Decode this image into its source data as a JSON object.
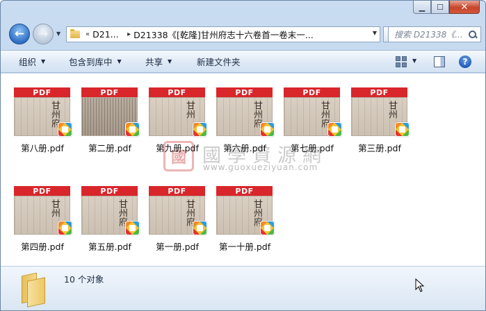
{
  "window": {
    "caption": {
      "minimize": "▁",
      "maximize": "☐",
      "close": "✕"
    }
  },
  "nav": {
    "back_icon": "back-arrow-icon",
    "forward_icon": "forward-arrow-icon",
    "breadcrumb": {
      "overflow": "«",
      "crumb_1": "D21...",
      "separator": "▸",
      "crumb_2": "D21338《[乾隆]甘州府志十六卷首一卷末一..."
    },
    "search_placeholder": "搜索 D21338《..."
  },
  "toolbar": {
    "organize": "组织",
    "include_in_library": "包含到库中",
    "share": "共享",
    "new_folder": "新建文件夹",
    "dropdown_arrow": "▼",
    "help": "?"
  },
  "files": [
    {
      "name": "第八册.pdf",
      "band": "PDF",
      "page_text": "甘州府"
    },
    {
      "name": "第二册.pdf",
      "band": "PDF",
      "page_text": ""
    },
    {
      "name": "第九册.pdf",
      "band": "PDF",
      "page_text": "甘州"
    },
    {
      "name": "第六册.pdf",
      "band": "PDF",
      "page_text": "甘州府"
    },
    {
      "name": "第七册.pdf",
      "band": "PDF",
      "page_text": "甘州府"
    },
    {
      "name": "第三册.pdf",
      "band": "PDF",
      "page_text": "甘州"
    },
    {
      "name": "第四册.pdf",
      "band": "PDF",
      "page_text": "甘州"
    },
    {
      "name": "第五册.pdf",
      "band": "PDF",
      "page_text": "甘州府"
    },
    {
      "name": "第一册.pdf",
      "band": "PDF",
      "page_text": "甘州府"
    },
    {
      "name": "第一十册.pdf",
      "band": "PDF",
      "page_text": "甘州府"
    }
  ],
  "watermark": {
    "logo": "國",
    "title": "國學資源網",
    "url": "www.guoxueziyuan.com"
  },
  "details": {
    "count": "10 个对象"
  },
  "colors": {
    "pdf_band": "#d8262b",
    "accent_blue": "#2e6fc4",
    "close_red": "#c7452b"
  }
}
